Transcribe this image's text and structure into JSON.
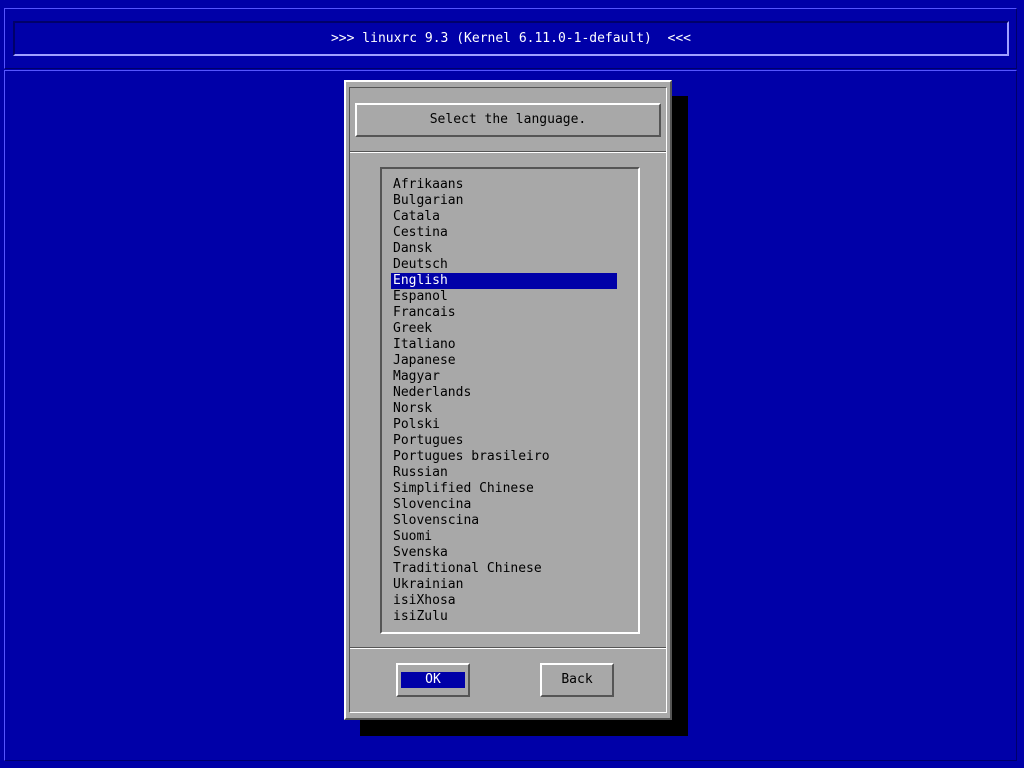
{
  "header": {
    "title": ">>> linuxrc 9.3 (Kernel 6.11.0-1-default)  <<<"
  },
  "dialog": {
    "prompt": "Select the language.",
    "languages": [
      "Afrikaans",
      "Bulgarian",
      "Catala",
      "Cestina",
      "Dansk",
      "Deutsch",
      "English",
      "Espanol",
      "Francais",
      "Greek",
      "Italiano",
      "Japanese",
      "Magyar",
      "Nederlands",
      "Norsk",
      "Polski",
      "Portugues",
      "Portugues brasileiro",
      "Russian",
      "Simplified Chinese",
      "Slovencina",
      "Slovenscina",
      "Suomi",
      "Svenska",
      "Traditional Chinese",
      "Ukrainian",
      "isiXhosa",
      "isiZulu"
    ],
    "selected_language": "English",
    "ok_label": "OK",
    "back_label": "Back",
    "focused_button": "OK"
  },
  "colors": {
    "background": "#0000a8",
    "dialog": "#a8a8a8",
    "highlight": "#0000a8",
    "highlight_text": "#ffffff"
  }
}
